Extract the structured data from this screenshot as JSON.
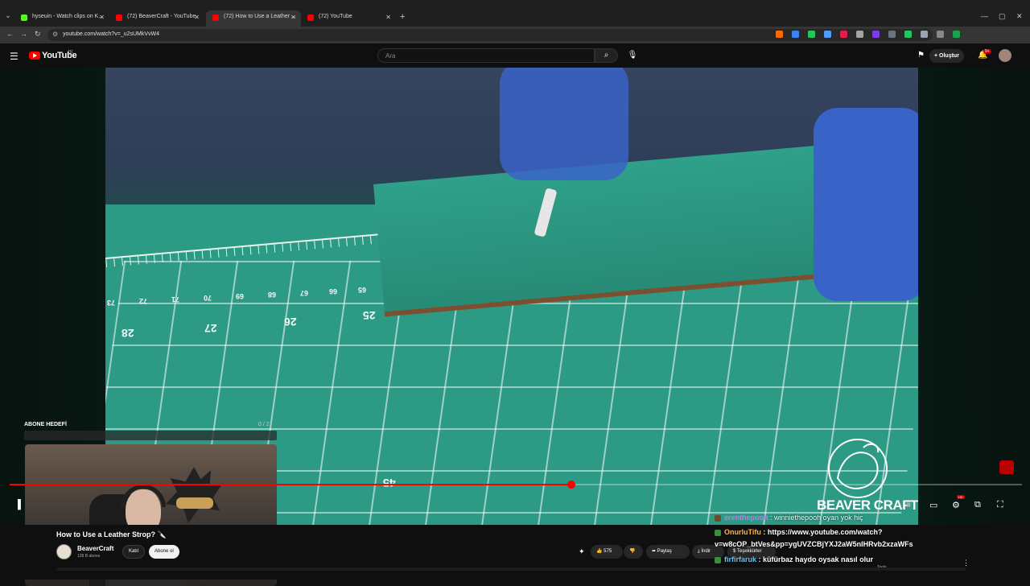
{
  "browser": {
    "tabs": [
      {
        "label": "hyseuin - Watch clips on K...",
        "favicon_color": "#53fc18",
        "active": false
      },
      {
        "label": "(72) BeaverCraft - YouTube",
        "favicon_color": "#ff0000",
        "active": false
      },
      {
        "label": "(72) How to Use a Leather ...",
        "favicon_color": "#ff0000",
        "active": true
      },
      {
        "label": "(72) YouTube",
        "favicon_color": "#ff0000",
        "active": false
      }
    ],
    "url": "youtube.com/watch?v=_u2sUMkVvW4",
    "extension_colors": [
      "#ff6a00",
      "#3b82f6",
      "#22c55e",
      "#4f9cff",
      "#e11d48",
      "#a3a3a3",
      "#7c3aed",
      "#6b7280",
      "#22c55e",
      "#9ca3af",
      "#888888",
      "#16a34a"
    ]
  },
  "youtube": {
    "logo_text": "YouTube",
    "country_code": "TR",
    "search_placeholder": "Ara",
    "create_label": "Oluştur",
    "notif_count": "9+"
  },
  "overlay": {
    "goal_label": "ABONE HEDEFİ",
    "goal_count": "0 / 2",
    "goal_progress": 0
  },
  "player": {
    "progress": 0.555,
    "watermark": "BEAVER CRAFT",
    "hd_label": "HD",
    "video_numbers": [
      "73",
      "72",
      "71",
      "70",
      "69",
      "68",
      "67",
      "66",
      "65",
      "28",
      "27",
      "26",
      "25",
      "45"
    ]
  },
  "video": {
    "title": "How to Use a Leather Strop? 🔪",
    "channel": "BeaverCraft",
    "subscribers": "128 B abone",
    "join_label": "Katıl",
    "subscribe_label": "Abone ol",
    "likes": "575",
    "share_label": "Paylaş",
    "download_label": "İndir",
    "thanks_label": "Teşekkürler",
    "related_label": "Tools"
  },
  "chat": [
    {
      "user": "erenthepooh",
      "message": ": winniethepooh oyan yok hiç",
      "color": "#b77de8"
    },
    {
      "user": "OnurluTifu",
      "message": ": https://www.youtube.com/watch?",
      "color": "#ffb347"
    },
    {
      "user": "",
      "message": "v=w8cOP_btVes&pp=ygUVZCBjYXJ2aW5nIHRvb2xzaWFs",
      "color": "#ffffff"
    },
    {
      "user": "firfirfaruk",
      "message": ": küfürbaz haydo oysak nasıl olur",
      "color": "#5fc4ff"
    }
  ]
}
